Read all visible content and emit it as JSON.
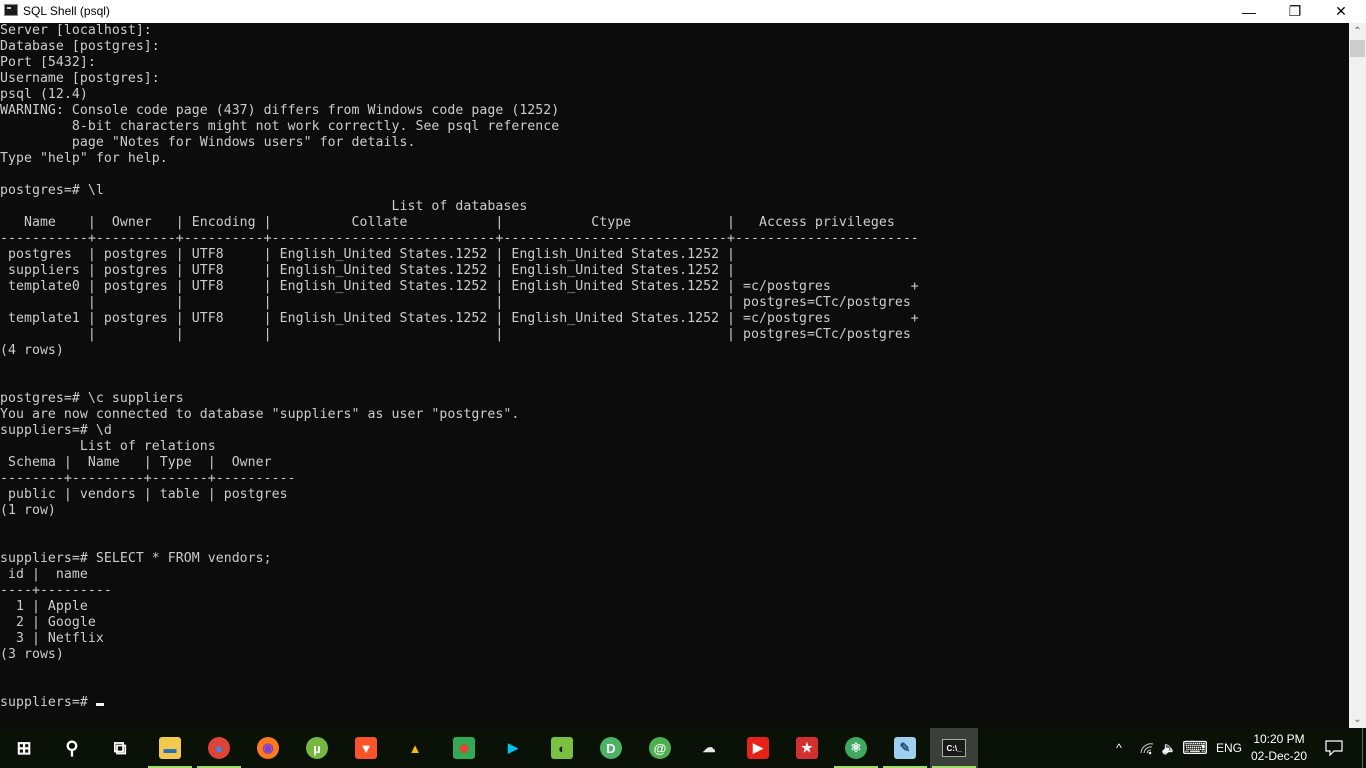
{
  "window": {
    "title": "SQL Shell (psql)",
    "icon": "console-icon",
    "controls": {
      "minimize": "—",
      "maximize": "❐",
      "close": "✕"
    }
  },
  "console": {
    "lines": [
      "Server [localhost]:",
      "Database [postgres]:",
      "Port [5432]:",
      "Username [postgres]:",
      "psql (12.4)",
      "WARNING: Console code page (437) differs from Windows code page (1252)",
      "         8-bit characters might not work correctly. See psql reference",
      "         page \"Notes for Windows users\" for details.",
      "Type \"help\" for help.",
      "",
      "postgres=# \\l",
      "                                                 List of databases",
      "   Name    |  Owner   | Encoding |          Collate           |           Ctype            |   Access privileges",
      "-----------+----------+----------+----------------------------+----------------------------+-----------------------",
      " postgres  | postgres | UTF8     | English_United States.1252 | English_United States.1252 |",
      " suppliers | postgres | UTF8     | English_United States.1252 | English_United States.1252 |",
      " template0 | postgres | UTF8     | English_United States.1252 | English_United States.1252 | =c/postgres          +",
      "           |          |          |                            |                            | postgres=CTc/postgres",
      " template1 | postgres | UTF8     | English_United States.1252 | English_United States.1252 | =c/postgres          +",
      "           |          |          |                            |                            | postgres=CTc/postgres",
      "(4 rows)",
      "",
      "",
      "postgres=# \\c suppliers",
      "You are now connected to database \"suppliers\" as user \"postgres\".",
      "suppliers=# \\d",
      "          List of relations",
      " Schema |  Name   | Type  |  Owner",
      "--------+---------+-------+----------",
      " public | vendors | table | postgres",
      "(1 row)",
      "",
      "",
      "suppliers=# SELECT * FROM vendors;",
      " id |  name",
      "----+---------",
      "  1 | Apple",
      "  2 | Google",
      "  3 | Netflix",
      "(3 rows)",
      "",
      ""
    ],
    "prompt": "suppliers=# ",
    "databases_table": {
      "title": "List of databases",
      "columns": [
        "Name",
        "Owner",
        "Encoding",
        "Collate",
        "Ctype",
        "Access privileges"
      ],
      "rows": [
        [
          "postgres",
          "postgres",
          "UTF8",
          "English_United States.1252",
          "English_United States.1252",
          ""
        ],
        [
          "suppliers",
          "postgres",
          "UTF8",
          "English_United States.1252",
          "English_United States.1252",
          ""
        ],
        [
          "template0",
          "postgres",
          "UTF8",
          "English_United States.1252",
          "English_United States.1252",
          "=c/postgres + postgres=CTc/postgres"
        ],
        [
          "template1",
          "postgres",
          "UTF8",
          "English_United States.1252",
          "English_United States.1252",
          "=c/postgres + postgres=CTc/postgres"
        ]
      ],
      "footer": "(4 rows)"
    },
    "relations_table": {
      "title": "List of relations",
      "columns": [
        "Schema",
        "Name",
        "Type",
        "Owner"
      ],
      "rows": [
        [
          "public",
          "vendors",
          "table",
          "postgres"
        ]
      ],
      "footer": "(1 row)"
    },
    "vendors_table": {
      "columns": [
        "id",
        "name"
      ],
      "rows": [
        [
          "1",
          "Apple"
        ],
        [
          "2",
          "Google"
        ],
        [
          "3",
          "Netflix"
        ]
      ],
      "footer": "(3 rows)"
    }
  },
  "scrollbar": {
    "up": "⌃",
    "down": "⌄"
  },
  "taskbar": {
    "items": [
      {
        "name": "start-button",
        "glyph": "⊞",
        "color": "#ffffff",
        "bg": "transparent"
      },
      {
        "name": "search-button",
        "glyph": "⚲",
        "color": "#ffffff",
        "bg": "transparent"
      },
      {
        "name": "task-view-button",
        "glyph": "⧉",
        "color": "#ffffff",
        "bg": "transparent"
      },
      {
        "name": "file-explorer",
        "glyph": "▬",
        "color": "#2b6fb8",
        "bg": "#f2c94c",
        "running": true
      },
      {
        "name": "chrome",
        "glyph": "●",
        "color": "#4285f4",
        "bg": "#db4437",
        "running": true
      },
      {
        "name": "firefox",
        "glyph": "◉",
        "color": "#7b3fd1",
        "bg": "#ff7a1a"
      },
      {
        "name": "utorrent",
        "glyph": "µ",
        "color": "#ffffff",
        "bg": "#76b83f"
      },
      {
        "name": "brave",
        "glyph": "▼",
        "color": "#ffffff",
        "bg": "#fb542b"
      },
      {
        "name": "google-drive",
        "glyph": "▲",
        "color": "#fbbc04",
        "bg": "transparent"
      },
      {
        "name": "google-maps",
        "glyph": "◆",
        "color": "#ea4335",
        "bg": "#34a853"
      },
      {
        "name": "google-play",
        "glyph": "▶",
        "color": "#00c0f0",
        "bg": "transparent"
      },
      {
        "name": "evernote",
        "glyph": "◐",
        "color": "#1a1a1a",
        "bg": "#7ac142"
      },
      {
        "name": "pushbullet",
        "glyph": "D",
        "color": "#ffffff",
        "bg": "#4ab367"
      },
      {
        "name": "spiral-app",
        "glyph": "@",
        "color": "#ffffff",
        "bg": "#4caf50"
      },
      {
        "name": "cloud-app",
        "glyph": "☁",
        "color": "#e8e8e8",
        "bg": "transparent"
      },
      {
        "name": "youtube",
        "glyph": "▶",
        "color": "#ffffff",
        "bg": "#e62117"
      },
      {
        "name": "bookmark-app",
        "glyph": "★",
        "color": "#ffffff",
        "bg": "#d32f2f"
      },
      {
        "name": "atom",
        "glyph": "⚛",
        "color": "#ffffff",
        "bg": "#40a860",
        "running": true
      },
      {
        "name": "notepad",
        "glyph": "✎",
        "color": "#2a4f7a",
        "bg": "#9fd0f0",
        "running": true
      },
      {
        "name": "sql-shell",
        "glyph": "C:\\_",
        "color": "#ffffff",
        "bg": "#1a1a1a",
        "running": true,
        "active": true
      }
    ],
    "tray": {
      "show_hidden": "^",
      "wifi": "wifi-icon",
      "volume": "🔈",
      "keyboard": "⌨",
      "language": "ENG",
      "time": "10:20 PM",
      "date": "02-Dec-20",
      "notifications": "🗨"
    }
  }
}
